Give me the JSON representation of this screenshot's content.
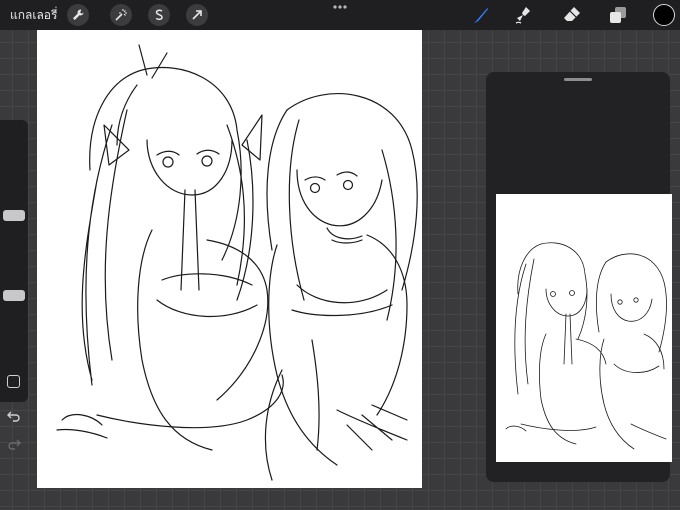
{
  "toolbar": {
    "gallery_label": "แกลเลอรี่",
    "left_tools": [
      "wrench-icon",
      "magic-wand-icon",
      "selection-icon",
      "transform-arrow-icon"
    ],
    "right_tools": [
      "brush-icon",
      "smudge-icon",
      "eraser-icon",
      "layers-icon"
    ],
    "active_tool": "brush",
    "accent_color": "#2f7dff",
    "current_color": "#000000"
  },
  "sidebar": {
    "brush_size_level": 0.36,
    "opacity_level": 0.63,
    "buttons": [
      "modify-button",
      "undo-button",
      "redo-button"
    ]
  },
  "reference_panel": {
    "content": "sketch-thumbnail"
  }
}
